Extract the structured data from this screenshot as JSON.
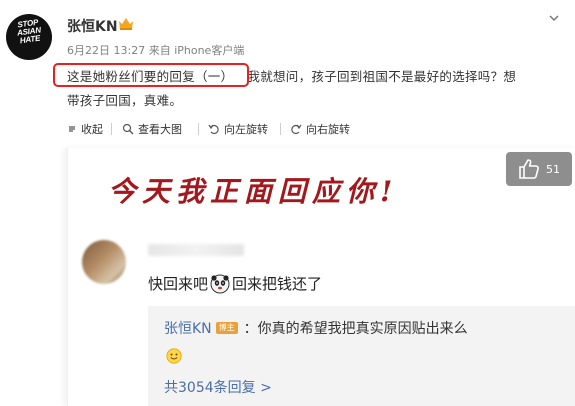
{
  "header": {
    "avatar_text": "STOP\nASIAN\nHATE",
    "username": "张恒KN",
    "timestamp": "6月22日 13:27",
    "source": "来自 iPhone客户端"
  },
  "post": {
    "line1_highlighted": "这是她粉丝们要的回复（一）",
    "line1_rest": "我就想问，孩子回到祖国不是最好的选择吗？想",
    "line2": "带孩子回国，真难。"
  },
  "toolbar": {
    "collapse": "收起",
    "view_large": "查看大图",
    "rotate_left": "向左旋转",
    "rotate_right": "向右旋转"
  },
  "image": {
    "title": "今天我正面回应你!",
    "like_count": "51",
    "comment_part1": "快回来吧",
    "comment_part2": "回来把钱还了",
    "reply_author": "张恒KN",
    "reply_badge": "博主",
    "reply_text": "：你真的希望我把真实原因贴出来么",
    "more_replies": "共3054条回复 >"
  },
  "icons": [
    "vip-crown-icon",
    "chevron-down-icon",
    "collapse-icon",
    "zoom-icon",
    "rotate-left-icon",
    "rotate-right-icon",
    "thumbs-up-icon",
    "panda-emoji-icon",
    "smile-emoji-icon"
  ],
  "colors": {
    "highlight": "#e82020",
    "title_red": "#a3181c",
    "link_blue": "#4a6ea9",
    "badge_orange": "#e6a23c"
  }
}
